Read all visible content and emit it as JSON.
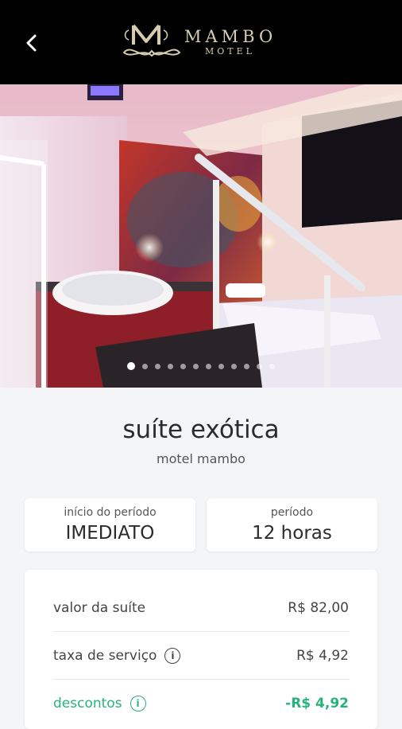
{
  "header": {
    "logo_word": "MAMBO",
    "logo_sub": "MOTEL"
  },
  "gallery": {
    "total_images": 12,
    "active_index": 0
  },
  "suite": {
    "name": "suíte exótica",
    "motel": "motel mambo"
  },
  "period_start": {
    "label": "início do período",
    "value": "IMEDIATO"
  },
  "period": {
    "label": "período",
    "value": "12 horas"
  },
  "pricing": {
    "rows": [
      {
        "label": "valor da suíte",
        "value": "R$ 82,00"
      },
      {
        "label": "taxa de serviço",
        "value": "R$ 4,92"
      },
      {
        "label": "descontos",
        "value": "-R$ 4,92"
      }
    ]
  },
  "colors": {
    "header_bg": "#000000",
    "logo_gold": "#d8ccb0",
    "discount_green": "#27b37a",
    "page_bg": "#f4f5f7"
  }
}
